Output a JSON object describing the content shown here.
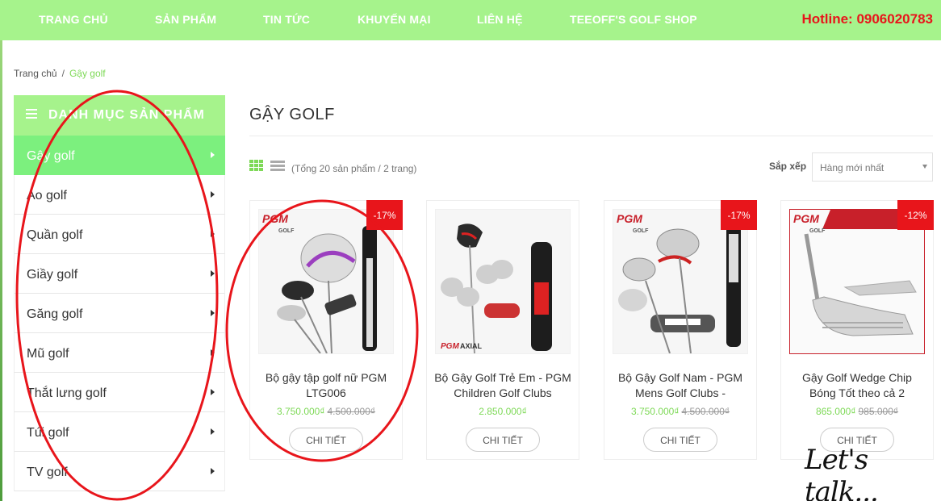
{
  "nav": {
    "items": [
      "TRANG CHỦ",
      "SẢN PHẨM",
      "TIN TỨC",
      "KHUYẾN MẠI",
      "LIÊN HỆ",
      "TEEOFF'S GOLF SHOP"
    ],
    "hotline": "Hotline: 0906020783"
  },
  "breadcrumb": {
    "home": "Trang chủ",
    "separator": "/",
    "current": "Gậy golf"
  },
  "sidebar": {
    "title": "DANH MỤC SẢN PHẨM",
    "items": [
      {
        "label": "Gậy golf",
        "active": true
      },
      {
        "label": "Áo golf"
      },
      {
        "label": "Quần golf"
      },
      {
        "label": "Giầy golf"
      },
      {
        "label": "Găng golf"
      },
      {
        "label": "Mũ golf"
      },
      {
        "label": "Thắt lưng golf"
      },
      {
        "label": "Túi golf"
      },
      {
        "label": "TV golf"
      }
    ]
  },
  "main": {
    "title": "GẬY GOLF",
    "total": "(Tổng 20 sản phẩm / 2 trang)",
    "sort_label": "Sắp xếp",
    "sort_value": "Hàng mới nhất"
  },
  "products": [
    {
      "badge": "-17%",
      "name": "Bộ gậy tập golf nữ PGM LTG006",
      "price": "3.750.000₫",
      "old_price": "4.500.000₫",
      "button": "CHI TIẾT"
    },
    {
      "badge": "",
      "name": "Bộ Gậy Golf Trẻ Em - PGM Children Golf Clubs",
      "price": "2.850.000₫",
      "old_price": "",
      "button": "CHI TIẾT"
    },
    {
      "badge": "-17%",
      "name": "Bộ Gậy Golf Nam - PGM Mens Golf Clubs -",
      "price": "3.750.000₫",
      "old_price": "4.500.000₫",
      "button": "CHI TIẾT"
    },
    {
      "badge": "-12%",
      "name": "Gậy Golf Wedge Chip Bóng Tốt theo cả 2",
      "price": "865.000₫",
      "old_price": "985.000₫",
      "button": "CHI TIẾT"
    }
  ],
  "brand": {
    "logo": "PGM",
    "sub": "GOLF",
    "axial": "AXIAL"
  },
  "chat": {
    "label": "Let's talk..."
  },
  "colors": {
    "nav_bg": "#a6f38c",
    "active_item": "#7cf07e",
    "price": "#7ed957",
    "badge": "#e8151b",
    "annotation": "#e8151b"
  }
}
